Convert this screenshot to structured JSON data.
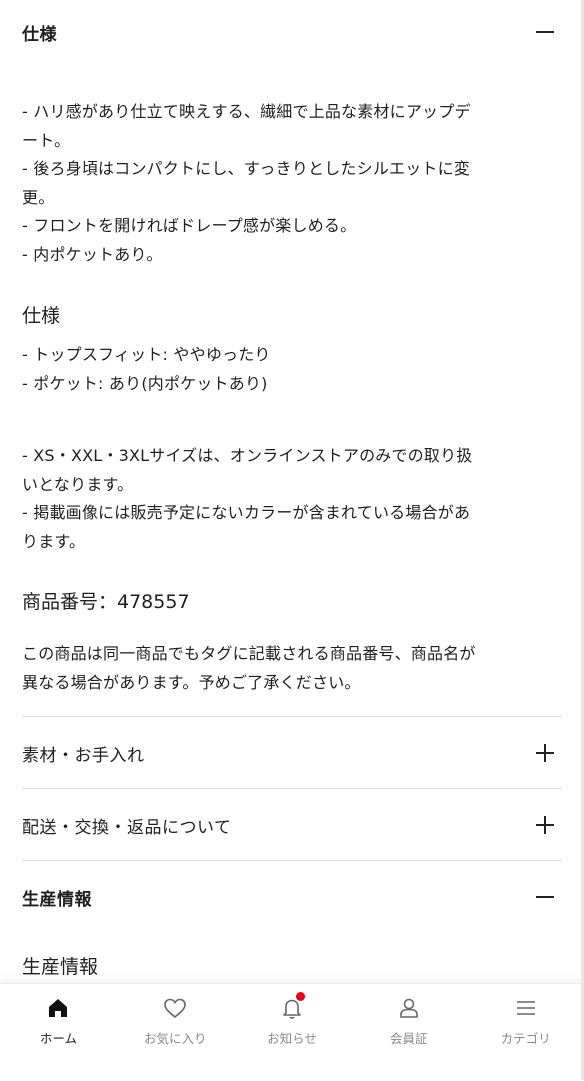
{
  "spec_section": {
    "title": "仕様",
    "toggle_icon": "minus-icon",
    "intro_lines": [
      "- ハリ感があり仕立て映えする、繊細で上品な素材にアップデ",
      "ート。",
      "- 後ろ身頃はコンパクトにし、すっきりとしたシルエットに変",
      "更。",
      "- フロントを開ければドレープ感が楽しめる。",
      "- 内ポケットあり。"
    ],
    "subheading": "仕様",
    "spec_lines": [
      "- トップスフィット: ややゆったり",
      "- ポケット: あり(内ポケットあり)"
    ],
    "note_lines": [
      "- XS・XXL・3XLサイズは、オンラインストアのみでの取り扱",
      "いとなります。",
      "- 掲載画像には販売予定にないカラーが含まれている場合があ",
      "ります。"
    ],
    "product_number": "商品番号：478557",
    "disclaimer_lines": [
      "この商品は同一商品でもタグに記載される商品番号、商品名が",
      "異なる場合があります。予めご了承ください。"
    ]
  },
  "material_section": {
    "title": "素材・お手入れ",
    "toggle_icon": "plus-icon"
  },
  "shipping_section": {
    "title": "配送・交換・返品について",
    "toggle_icon": "plus-icon"
  },
  "production_section": {
    "title": "生産情報",
    "toggle_icon": "minus-icon",
    "subheading": "生産情報"
  },
  "bottom_nav": {
    "items": [
      {
        "label": "ホーム",
        "icon": "home-icon",
        "active": true
      },
      {
        "label": "お気に入り",
        "icon": "heart-icon",
        "active": false
      },
      {
        "label": "お知らせ",
        "icon": "bell-icon",
        "active": false,
        "badge_color": "#e60012"
      },
      {
        "label": "会員証",
        "icon": "person-icon",
        "active": false
      },
      {
        "label": "カテゴリ",
        "icon": "menu-icon",
        "active": false
      }
    ]
  }
}
